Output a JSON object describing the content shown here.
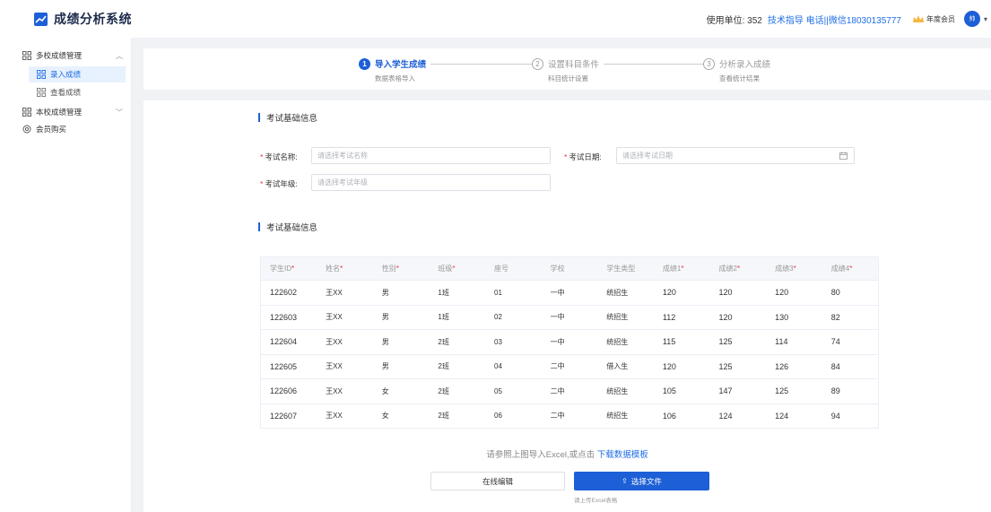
{
  "app": {
    "title": "成绩分析系统"
  },
  "header": {
    "unit_label": "使用单位: 352",
    "support_label": "技术指导 电话||微信18030135777",
    "member_label": "年度会员",
    "avatar_text": "帅",
    "accent_color": "#1d5fd6"
  },
  "sidebar": {
    "groups": [
      {
        "label": "多校成绩管理",
        "icon": "grid-icon",
        "expanded": true
      },
      {
        "label": "本校成绩管理",
        "icon": "grid-icon",
        "expanded": false
      },
      {
        "label": "会员购买",
        "icon": "gear-icon"
      }
    ],
    "sub_items": [
      {
        "label": "录入成绩",
        "active": true
      },
      {
        "label": "查看成绩",
        "active": false
      }
    ]
  },
  "steps": [
    {
      "num": "1",
      "title": "导入学生成绩",
      "desc": "数据表格导入",
      "active": true
    },
    {
      "num": "2",
      "title": "设置科目条件",
      "desc": "科目统计设置",
      "active": false
    },
    {
      "num": "3",
      "title": "分析录入成绩",
      "desc": "查看统计结果",
      "active": false
    }
  ],
  "form": {
    "section_title": "考试基础信息",
    "exam_name_label": "考试名称:",
    "exam_name_placeholder": "请选择考试名称",
    "exam_date_label": "考试日期:",
    "exam_date_placeholder": "请选择考试日期",
    "exam_grade_label": "考试年级:",
    "exam_grade_placeholder": "请选择考试年级"
  },
  "table": {
    "section_title": "考试基础信息",
    "columns": [
      {
        "label": "学生ID",
        "required": true
      },
      {
        "label": "姓名",
        "required": true
      },
      {
        "label": "性别",
        "required": true
      },
      {
        "label": "班级",
        "required": true
      },
      {
        "label": "座号",
        "required": false
      },
      {
        "label": "学校",
        "required": false
      },
      {
        "label": "学生类型",
        "required": false
      },
      {
        "label": "成绩1",
        "required": true
      },
      {
        "label": "成绩2",
        "required": true
      },
      {
        "label": "成绩3",
        "required": true
      },
      {
        "label": "成绩4",
        "required": true
      }
    ],
    "rows": [
      [
        "122602",
        "王XX",
        "男",
        "1班",
        "01",
        "一中",
        "统招生",
        "120",
        "120",
        "120",
        "80"
      ],
      [
        "122603",
        "王XX",
        "男",
        "1班",
        "02",
        "一中",
        "统招生",
        "112",
        "120",
        "130",
        "82"
      ],
      [
        "122604",
        "王XX",
        "男",
        "2班",
        "03",
        "一中",
        "统招生",
        "115",
        "125",
        "114",
        "74"
      ],
      [
        "122605",
        "王XX",
        "男",
        "2班",
        "04",
        "二中",
        "借入生",
        "120",
        "125",
        "126",
        "84"
      ],
      [
        "122606",
        "王XX",
        "女",
        "2班",
        "05",
        "二中",
        "统招生",
        "105",
        "147",
        "125",
        "89"
      ],
      [
        "122607",
        "王XX",
        "女",
        "2班",
        "06",
        "二中",
        "统招生",
        "106",
        "124",
        "124",
        "94"
      ]
    ]
  },
  "import": {
    "hint_text": "请参照上图导入Excel,或点击",
    "download_link": "下载数据模板",
    "online_edit_label": "在线编辑",
    "upload_label": "选择文件",
    "upload_tip": "请上传Excel表格"
  }
}
